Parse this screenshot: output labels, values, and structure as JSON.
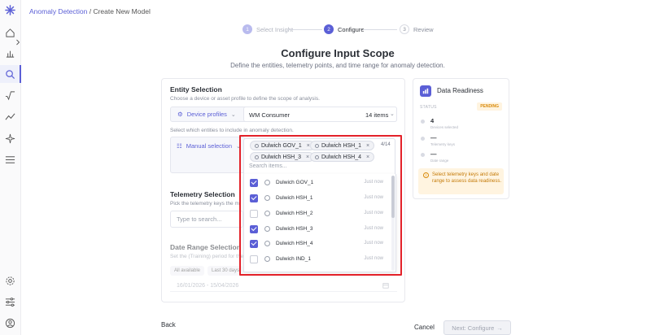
{
  "breadcrumb": {
    "parent": "Anomaly Detection",
    "separator": " / ",
    "current": "Create New Model"
  },
  "stepper": [
    {
      "num": "1",
      "label": "Select Insight",
      "state": "done"
    },
    {
      "num": "2",
      "label": "Configure",
      "state": "active"
    },
    {
      "num": "3",
      "label": "Review",
      "state": "upcoming"
    }
  ],
  "page": {
    "title": "Configure Input Scope",
    "subtitle": "Define the entities, telemetry points, and time range for anomaly detection."
  },
  "entity": {
    "title": "Entity Selection",
    "desc": "Choose a device or asset profile to define the scope of analysis.",
    "profile_type": "Device profiles",
    "profile_value": "WM Consumer",
    "items_count": "14 items",
    "select_desc": "Select which entities to include in anomaly detection.",
    "selection_mode": "Manual selection",
    "selected_count": "4/14",
    "chips": [
      "Dulwich GOV_1",
      "Dulwich HSH_1",
      "Dulwich HSH_3",
      "Dulwich HSH_4"
    ],
    "search_placeholder": "Search items...",
    "items": [
      {
        "name": "Dulwich GOV_1",
        "time": "Just now",
        "checked": true
      },
      {
        "name": "Dulwich HSH_1",
        "time": "Just now",
        "checked": true
      },
      {
        "name": "Dulwich HSH_2",
        "time": "Just now",
        "checked": false
      },
      {
        "name": "Dulwich HSH_3",
        "time": "Just now",
        "checked": true
      },
      {
        "name": "Dulwich HSH_4",
        "time": "Just now",
        "checked": true
      },
      {
        "name": "Dulwich IND_1",
        "time": "Just now",
        "checked": false
      }
    ]
  },
  "telemetry": {
    "title": "Telemetry Selection",
    "desc": "Pick the telemetry keys the m",
    "placeholder": "Type to search..."
  },
  "daterange": {
    "title": "Date Range Selection",
    "desc": "Set the (Training) period for the",
    "chip_all": "All available",
    "chip_30": "Last 30 days",
    "value": "16/01/2026 - 15/04/2026"
  },
  "readiness": {
    "title": "Data Readiness",
    "status_label": "STATUS",
    "status": "PENDING",
    "stats": [
      {
        "value": "4",
        "label": "Devices selected"
      },
      {
        "value": "—",
        "label": "Telemetry keys"
      },
      {
        "value": "—",
        "label": "Date range"
      }
    ],
    "warning": "Select telemetry keys and date range to assess data readiness."
  },
  "footer": {
    "back": "Back",
    "cancel": "Cancel",
    "next": "Next: Configure",
    "next_arrow": "→"
  },
  "colors": {
    "accent": "#5b5fd6",
    "highlight": "#e32129",
    "pending": "#d98a0a"
  }
}
